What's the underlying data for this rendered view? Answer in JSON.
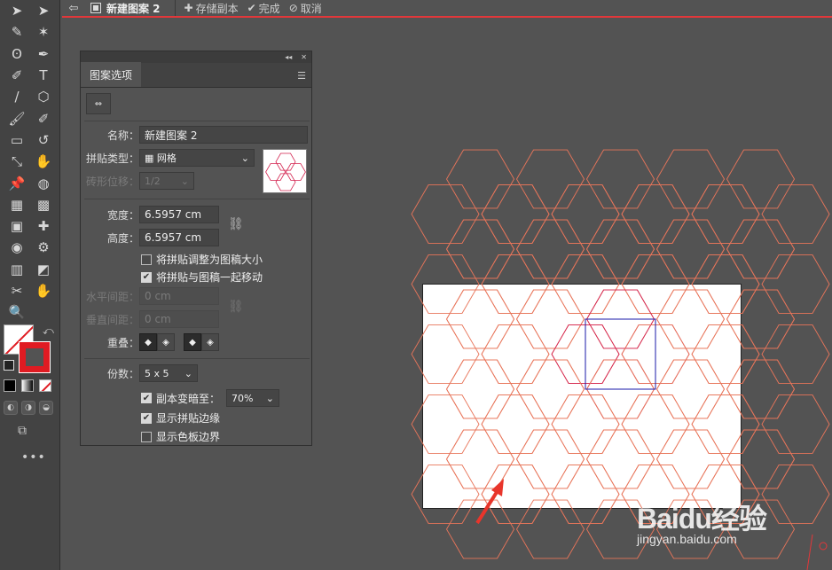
{
  "topbar": {
    "doc_title": "新建图案 2",
    "save_copy": "存储副本",
    "done": "完成",
    "cancel": "取消"
  },
  "toolbar": {
    "tools": [
      "selection-tool",
      "direct-selection-tool",
      "curvature-pen-tool",
      "magic-wand-tool",
      "lasso-tool",
      "pen-tool",
      "pencil-tool",
      "type-tool",
      "line-segment-tool",
      "polygon-tool",
      "paintbrush-tool",
      "blob-brush-tool",
      "eraser-tool",
      "rotate-tool",
      "scale-tool",
      "warp-tool",
      "pin-tool",
      "shape-builder-tool",
      "perspective-grid-tool",
      "mesh-tool",
      "gradient-tool",
      "eyedropper-tool",
      "blend-tool",
      "symbol-sprayer-tool",
      "column-graph-tool",
      "slice-tool",
      "knife-tool",
      "hand-tool",
      "zoom-tool"
    ],
    "tool_glyphs": [
      "➤",
      "➤",
      "✎",
      "✶",
      "ʘ",
      "✒",
      "✐",
      "T",
      "/",
      "⬡",
      "🖌",
      "✐",
      "▭",
      "↺",
      "⤡",
      "✋",
      "📌",
      "◍",
      "▦",
      "▩",
      "▣",
      "✚",
      "◉",
      "⚙",
      "▥",
      "◩",
      "✂",
      "✋",
      "🔍"
    ],
    "more": "•••"
  },
  "panel": {
    "tab": "图案选项",
    "name_label": "名称：",
    "name_value": "新建图案 2",
    "tile_type_label": "拼贴类型：",
    "tile_type_value": "网格",
    "tile_type_icon": "grid-icon",
    "brick_offset_label": "砖形位移：",
    "brick_offset_value": "1/2",
    "width_label": "宽度：",
    "width_value": "6.5957 cm",
    "height_label": "高度：",
    "height_value": "6.5957 cm",
    "resize_to_art": "将拼贴调整为图稿大小",
    "resize_to_art_checked": false,
    "move_with_art": "将拼贴与图稿一起移动",
    "move_with_art_checked": true,
    "h_spacing_label": "水平间距：",
    "h_spacing_value": "0 cm",
    "v_spacing_label": "垂直间距：",
    "v_spacing_value": "0 cm",
    "overlap_label": "重叠：",
    "copies_label": "份数：",
    "copies_value": "5 x 5",
    "dim_copies": "副本变暗至：",
    "dim_copies_checked": true,
    "dim_copies_value": "70%",
    "show_tile_edge": "显示拼贴边缘",
    "show_tile_edge_checked": true,
    "show_swatch_bounds": "显示色板边界",
    "show_swatch_bounds_checked": false
  },
  "colors": {
    "pattern_stroke": "#e8755a",
    "center_stroke": "#d4234f",
    "tile_edge": "#1a1aa8",
    "accent": "#e2373a"
  },
  "watermark": {
    "brand": "Baidu经验",
    "url": "jingyan.baidu.com"
  }
}
